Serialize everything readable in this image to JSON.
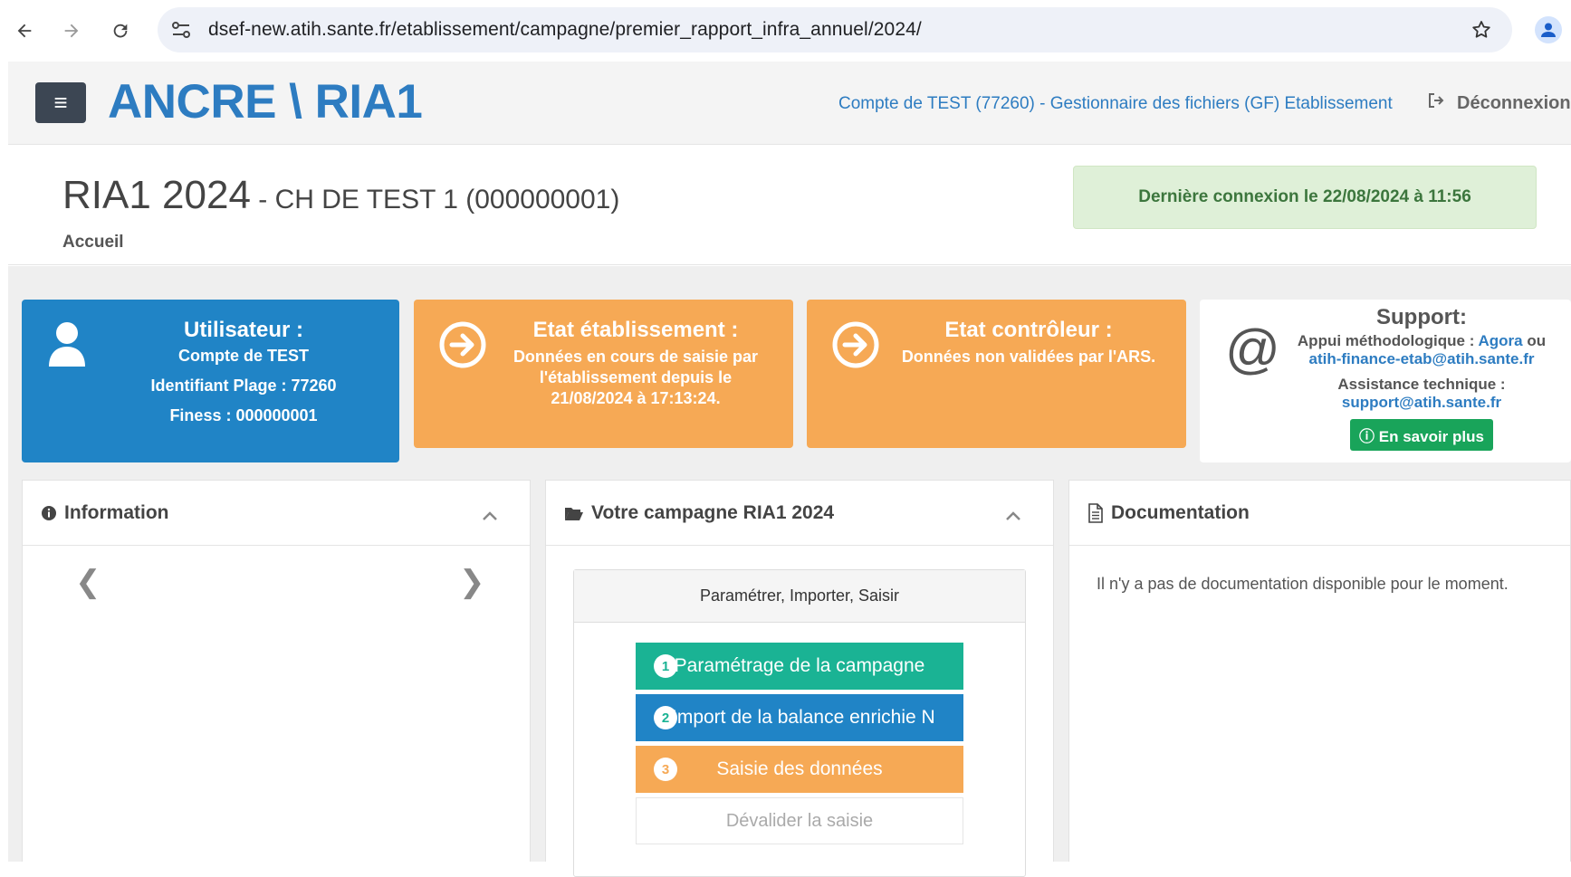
{
  "browser": {
    "url": "dsef-new.atih.sante.fr/etablissement/campagne/premier_rapport_infra_annuel/2024/"
  },
  "header": {
    "menu_icon": "hamburger-icon",
    "app_title": "ANCRE  \\ RIA1",
    "account": "Compte de TEST (77260) - Gestionnaire des fichiers (GF) Etablissement",
    "logout": "Déconnexion"
  },
  "page": {
    "title": "RIA1 2024",
    "subtitle": " - CH DE TEST 1 (000000001)",
    "breadcrumb": "Accueil",
    "last_login": "Dernière connexion le 22/08/2024 à 11:56"
  },
  "tiles": {
    "user": {
      "title": "Utilisateur :",
      "line1": "Compte de TEST",
      "line2": "Identifiant Plage : 77260",
      "line3": "Finess : 000000001"
    },
    "etab": {
      "title": "Etat établissement :",
      "line1": "Données en cours de saisie par l'établissement depuis le 21/08/2024 à 17:13:24."
    },
    "ctrl": {
      "title": "Etat contrôleur :",
      "line1": "Données non validées par l'ARS."
    },
    "support": {
      "title": "Support:",
      "methodo_label": "Appui méthodologique : ",
      "methodo_link": "Agora",
      "methodo_or": " ou",
      "methodo_email": "atih-finance-etab@atih.sante.fr",
      "tech_label": "Assistance technique :",
      "tech_email": "support@atih.sante.fr",
      "more_button": "En savoir plus"
    }
  },
  "panels": {
    "information": {
      "title": "Information",
      "prev": "❮",
      "next": "❯"
    },
    "campaign": {
      "title": "Votre campagne RIA1 2024",
      "box_title": "Paramétrer, Importer, Saisir",
      "steps": [
        {
          "num": "1",
          "label": "Paramétrage de la campagne"
        },
        {
          "num": "2",
          "label": "Import de la balance enrichie N"
        },
        {
          "num": "3",
          "label": "Saisie des données"
        },
        {
          "label": "Dévalider la saisie"
        }
      ]
    },
    "documentation": {
      "title": "Documentation",
      "empty": "Il n'y a pas de documentation disponible pour le moment."
    }
  },
  "colors": {
    "primary_blue": "#2084c6",
    "orange": "#f6a955",
    "green": "#1ab394",
    "success_green": "#19a45a"
  }
}
